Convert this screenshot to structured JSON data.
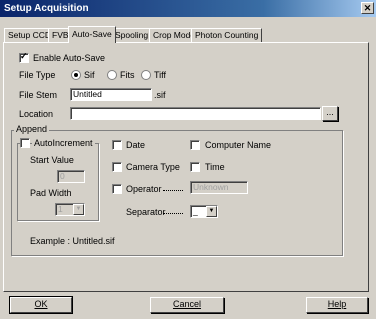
{
  "window": {
    "title": "Setup Acquisition",
    "close": "✕"
  },
  "tabs": [
    "Setup CCD",
    "FVB",
    "Auto-Save",
    "Spooling",
    "Crop Mode",
    "Photon Counting"
  ],
  "autosave": {
    "enable_label": "Enable Auto-Save",
    "file_type_label": "File Type",
    "file_types": [
      "Sif",
      "Fits",
      "Tiff"
    ],
    "file_stem_label": "File Stem",
    "file_stem_value": "Untitled",
    "extension": ".sif",
    "location_label": "Location",
    "location_value": "",
    "browse": "..."
  },
  "append": {
    "group_label": "Append",
    "autoincrement_label": "AutoIncrement",
    "start_value_label": "Start Value",
    "start_value": "0",
    "pad_width_label": "Pad Width",
    "pad_width": "1",
    "date_label": "Date",
    "computer_name_label": "Computer Name",
    "camera_type_label": "Camera Type",
    "time_label": "Time",
    "operator_label": "Operator",
    "operator_value": "Unknown",
    "separator_label": "Separator",
    "separator_value": "_",
    "example": "Example : Untitled.sif"
  },
  "buttons": {
    "ok": "OK",
    "cancel": "Cancel",
    "help": "Help"
  },
  "icons": {
    "radio_on": "radio-selected-icon",
    "dropdown": "chevron-down-icon"
  }
}
